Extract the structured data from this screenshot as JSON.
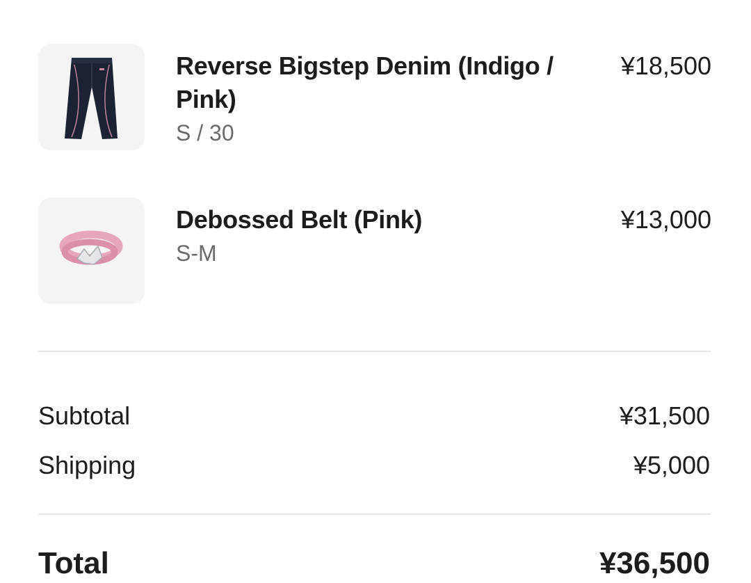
{
  "items": [
    {
      "name": "Reverse Bigstep Denim (Indigo / Pink)",
      "variant": "S / 30",
      "price": "¥18,500",
      "thumbnail_icon": "denim-pants-icon"
    },
    {
      "name": "Debossed Belt (Pink)",
      "variant": "S-M",
      "price": "¥13,000",
      "thumbnail_icon": "pink-belt-icon"
    }
  ],
  "summary": {
    "subtotal_label": "Subtotal",
    "subtotal_value": "¥31,500",
    "shipping_label": "Shipping",
    "shipping_value": "¥5,000",
    "total_label": "Total",
    "total_value": "¥36,500"
  },
  "colors": {
    "text": "#1c1c1c",
    "muted": "#6b6b6b",
    "thumb_bg": "#f4f4f4",
    "divider": "#e6e6e6",
    "denim": "#1b2233",
    "belt_pink": "#e8a6bd"
  }
}
